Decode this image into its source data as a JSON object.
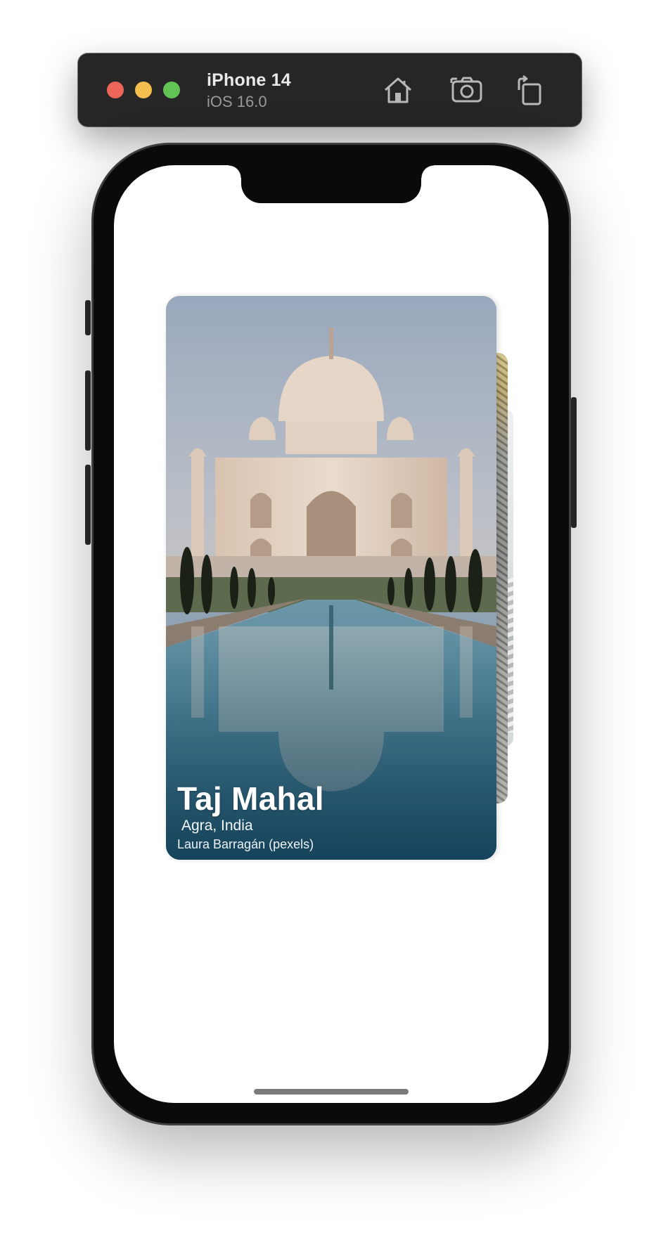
{
  "toolbar": {
    "device_name": "iPhone 14",
    "os_version": "iOS 16.0",
    "actions": [
      "home-icon",
      "screenshot-icon",
      "rotate-icon"
    ]
  },
  "card": {
    "title": "Taj Mahal",
    "location": "Agra, India",
    "credit": "Laura Barragán (pexels)"
  },
  "colors": {
    "close": "#ec6559",
    "minimize": "#f4bf4f",
    "zoom": "#61c454",
    "toolbar_bg": "#262626"
  }
}
